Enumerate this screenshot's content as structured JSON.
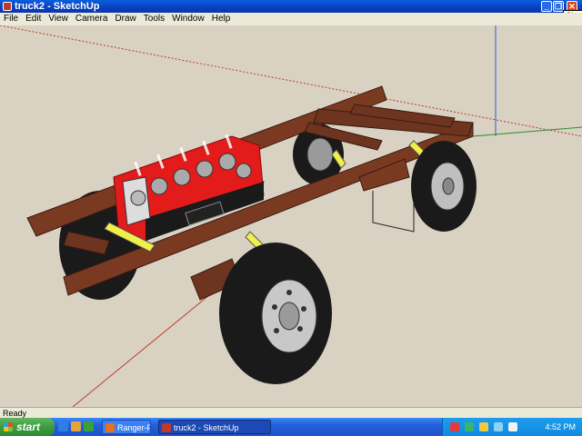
{
  "window": {
    "title": "truck2 - SketchUp",
    "close_tooltip": "Close",
    "minimize_glyph": "_",
    "maximize_glyph": "❐",
    "close_glyph": "✕"
  },
  "menu": [
    "File",
    "Edit",
    "View",
    "Camera",
    "Draw",
    "Tools",
    "Window",
    "Help"
  ],
  "status": {
    "text": "Ready"
  },
  "taskbar": {
    "start_label": "start",
    "tasks": [
      {
        "label": "Ranger-Forums.com -...",
        "icon": "firefox-icon"
      },
      {
        "label": "truck2 - SketchUp",
        "icon": "sketchup-icon"
      }
    ],
    "clock": "4:52 PM"
  },
  "colors": {
    "title_bar": "#0a3fbf",
    "frame_rust": "#7a3a22",
    "engine_red": "#e31b1b",
    "leaf_spring": "#f0f04a",
    "tire": "#1a1a1a",
    "sky": "#d9d2c2"
  }
}
